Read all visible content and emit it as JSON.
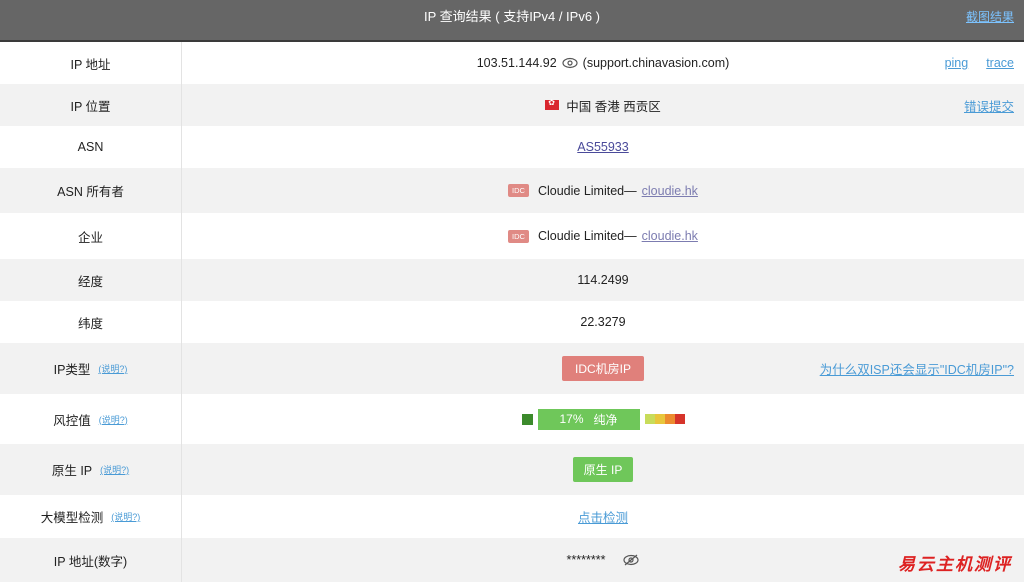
{
  "header": {
    "title": "IP 查询结果 ( 支持IPv4 / IPv6 )",
    "screenshot_link": "截图结果"
  },
  "rows": {
    "ip": {
      "label": "IP 地址",
      "ip": "103.51.144.92",
      "host": "(support.chinavasion.com)",
      "ping": "ping",
      "trace": "trace"
    },
    "location": {
      "label": "IP 位置",
      "value": "中国 香港 西贡区",
      "report": "错误提交"
    },
    "asn": {
      "label": "ASN",
      "value": "AS55933"
    },
    "asn_owner": {
      "label": "ASN 所有者",
      "badge": "IDC",
      "name": "Cloudie Limited—",
      "domain": "cloudie.hk"
    },
    "company": {
      "label": "企业",
      "badge": "IDC",
      "name": "Cloudie Limited—",
      "domain": "cloudie.hk"
    },
    "longitude": {
      "label": "经度",
      "value": "114.2499"
    },
    "latitude": {
      "label": "纬度",
      "value": "22.3279"
    },
    "ip_type": {
      "label": "IP类型",
      "help": "(说明?)",
      "value": "IDC机房IP",
      "question": "为什么双ISP还会显示\"IDC机房IP\"?"
    },
    "risk": {
      "label": "风控值",
      "help": "(说明?)",
      "percent": "17%",
      "text": "纯净",
      "strip_colors": [
        "#c8dc5a",
        "#e8c63c",
        "#ec8b2f",
        "#d6342a"
      ]
    },
    "native": {
      "label": "原生 IP",
      "help": "(说明?)",
      "value": "原生 IP"
    },
    "llm": {
      "label": "大模型检测",
      "help": "(说明?)",
      "value": "点击检测"
    },
    "ip_numeric": {
      "label": "IP 地址(数字)",
      "value": "********"
    }
  },
  "watermark": "易云主机测评",
  "colors": {
    "header_bg": "#666666",
    "link": "#4a9bd6",
    "green": "#6fc75a",
    "red_badge": "#e0807b"
  }
}
